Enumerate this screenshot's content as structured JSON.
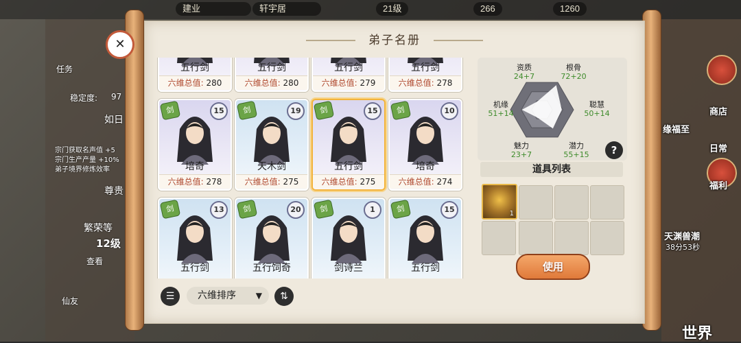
{
  "topbar": {
    "items": [
      "建业",
      "轩宇居",
      "21级",
      "266",
      "1260"
    ]
  },
  "left_panel": {
    "task_label": "任务",
    "stability_label": "稳定度:",
    "stability_value": "97",
    "sect_name": "如日",
    "sect_desc": [
      "宗门获取名声值 +5",
      "宗门生产产量 +10%",
      "弟子境界修炼效率"
    ],
    "honor_label": "尊贵",
    "prosperity_label": "繁荣等",
    "prosperity_level": "12级",
    "view_label": "查看",
    "friend_label": "仙友"
  },
  "right_panel": {
    "shop_label": "商店",
    "fortune_label": "缘福至",
    "daily_label": "日常",
    "welfare_label": "福利",
    "event_name": "天渊兽潮",
    "event_timer": "38分53秒",
    "world_label": "世界"
  },
  "panel": {
    "title": "弟子名册",
    "sort_label": "六维排序",
    "use_label": "使用",
    "items_title": "道具列表",
    "item_count": "1",
    "help_label": "?"
  },
  "disciples": [
    {
      "name": "五行剑",
      "sum_label": "六维总值:",
      "sum": "280",
      "level": "",
      "bg": "lavender"
    },
    {
      "name": "五行剑",
      "sum_label": "六维总值:",
      "sum": "280",
      "level": "",
      "bg": "lavender"
    },
    {
      "name": "五行剑",
      "sum_label": "六维总值:",
      "sum": "279",
      "level": "",
      "bg": "lavender"
    },
    {
      "name": "五行剑",
      "sum_label": "六维总值:",
      "sum": "278",
      "level": "",
      "bg": "lavender"
    },
    {
      "name": "培奇",
      "sum_label": "六维总值:",
      "sum": "278",
      "level": "15",
      "bg": "lavender"
    },
    {
      "name": "天木剑",
      "sum_label": "六维总值:",
      "sum": "275",
      "level": "19",
      "bg": "blue"
    },
    {
      "name": "五行剑",
      "sum_label": "六维总值:",
      "sum": "275",
      "level": "15",
      "bg": "lavender",
      "selected": true
    },
    {
      "name": "培奇",
      "sum_label": "六维总值:",
      "sum": "274",
      "level": "10",
      "bg": "lavender"
    },
    {
      "name": "五行剑",
      "sum_label": "",
      "sum": "",
      "level": "13",
      "bg": "blue"
    },
    {
      "name": "五行饲奇",
      "sum_label": "",
      "sum": "",
      "level": "20",
      "bg": "blue"
    },
    {
      "name": "剑诗兰",
      "sum_label": "",
      "sum": "",
      "level": "1",
      "bg": "blue"
    },
    {
      "name": "五行剑",
      "sum_label": "",
      "sum": "",
      "level": "15",
      "bg": "blue"
    }
  ],
  "stats": {
    "aptitude": {
      "label": "资质",
      "value": "24+7",
      "base": 24
    },
    "root": {
      "label": "根骨",
      "value": "72+20",
      "base": 72
    },
    "wisdom": {
      "label": "聪慧",
      "value": "50+14",
      "base": 50
    },
    "potential": {
      "label": "潜力",
      "value": "55+15",
      "base": 55
    },
    "charm": {
      "label": "魅力",
      "value": "23+7",
      "base": 23
    },
    "fortune": {
      "label": "机缘",
      "value": "51+14",
      "base": 51
    }
  },
  "colors": {
    "paper": "#efe9dd",
    "accent": "#e07a3a",
    "stat_green": "#3d8b2a",
    "sum_red": "#b04a30"
  }
}
